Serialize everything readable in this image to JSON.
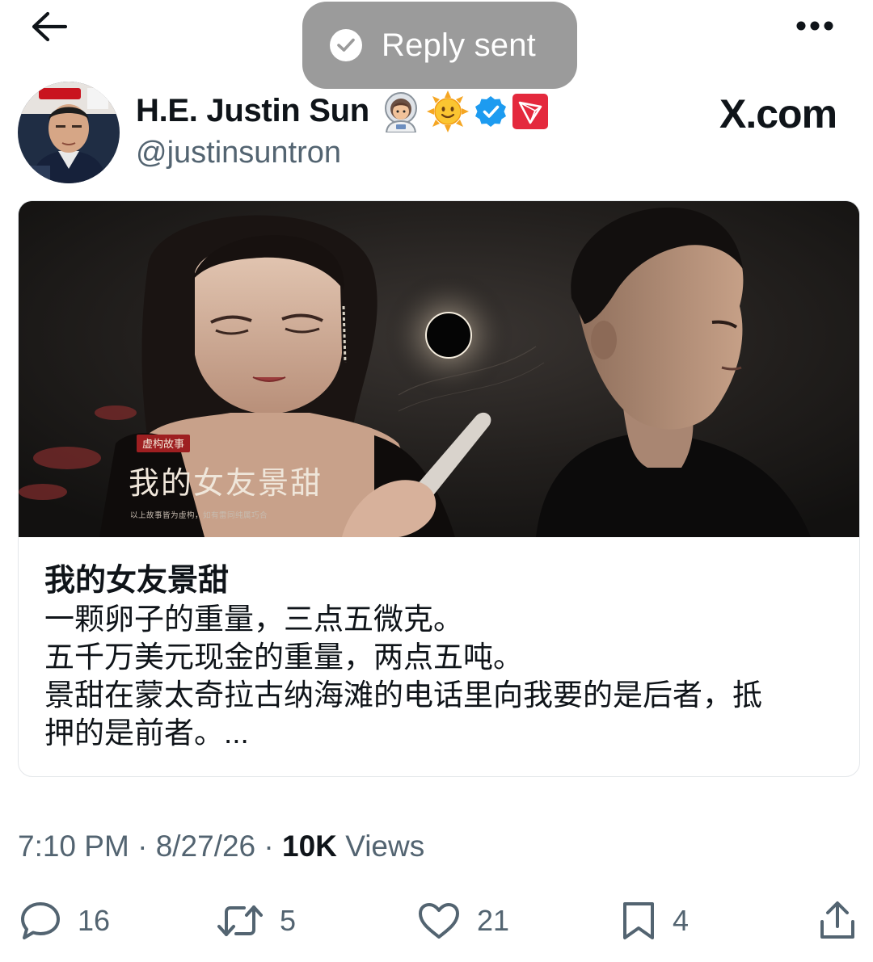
{
  "toast": {
    "text": "Reply sent"
  },
  "author": {
    "name": "H.E. Justin Sun",
    "handle": "@justinsuntron",
    "badges": [
      "astronaut-emoji",
      "sun-face-emoji",
      "verified-badge",
      "tron-logo"
    ]
  },
  "source_label": "X.com",
  "card": {
    "image_text": {
      "tag": "虚构故事",
      "title": "我的女友景甜",
      "disclaimer": "以上故事皆为虚构，如有雷同纯属巧合"
    },
    "title": "我的女友景甜",
    "description_lines": [
      "一颗卵子的重量，三点五微克。",
      "五千万美元现金的重量，两点五吨。",
      "景甜在蒙太奇拉古纳海滩的电话里向我要的是后者，抵",
      "押的是前者。..."
    ]
  },
  "meta": {
    "time": "7:10 PM",
    "separator": " · ",
    "date": "8/27/26",
    "views_count": "10K",
    "views_label": " Views"
  },
  "actions": {
    "replies": "16",
    "reposts": "5",
    "likes": "21",
    "bookmarks": "4"
  },
  "colors": {
    "text_primary": "#0f1419",
    "text_secondary": "#536471",
    "toast_bg": "#9b9b9b",
    "verified": "#1d9bf0",
    "tron_red": "#e4293d"
  }
}
